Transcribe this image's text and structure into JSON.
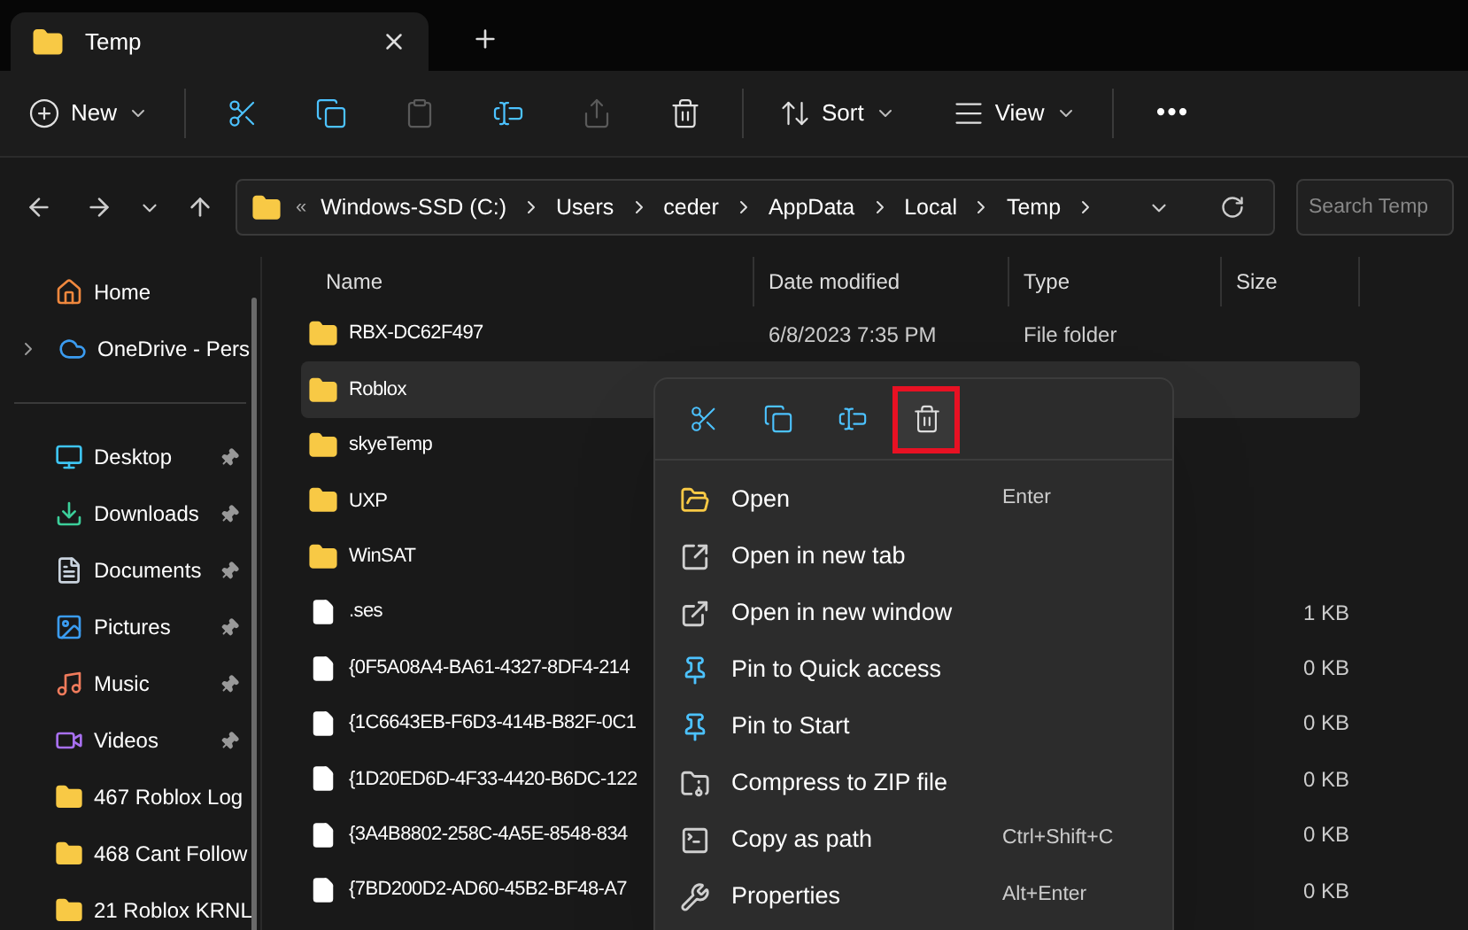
{
  "tab": {
    "title": "Temp",
    "selected": true
  },
  "toolbar": [
    {
      "kind": "new",
      "label": "New",
      "disabled": false
    },
    {
      "kind": "cut",
      "disabled": false
    },
    {
      "kind": "copy",
      "disabled": false
    },
    {
      "kind": "paste",
      "disabled": true
    },
    {
      "kind": "rename",
      "disabled": false
    },
    {
      "kind": "share",
      "disabled": true
    },
    {
      "kind": "delete",
      "disabled": false
    },
    {
      "kind": "sort",
      "label": "Sort",
      "disabled": false
    },
    {
      "kind": "view",
      "label": "View",
      "disabled": false
    },
    {
      "kind": "more",
      "label": "•••",
      "disabled": false
    }
  ],
  "address": {
    "overflow": "«",
    "crumbs": [
      "Windows-SSD (C:)",
      "Users",
      "ceder",
      "AppData",
      "Local",
      "Temp"
    ]
  },
  "search": {
    "placeholder": "Search Temp"
  },
  "sidebar": {
    "items": [
      {
        "kind": "home",
        "label": "Home",
        "pinned": false
      },
      {
        "kind": "cloud",
        "label": "OneDrive - Pers",
        "pinned": false
      },
      {
        "kind": "desktop",
        "label": "Desktop",
        "pinned": true
      },
      {
        "kind": "downloads",
        "label": "Downloads",
        "pinned": true
      },
      {
        "kind": "documents",
        "label": "Documents",
        "pinned": true
      },
      {
        "kind": "pictures",
        "label": "Pictures",
        "pinned": true
      },
      {
        "kind": "music",
        "label": "Music",
        "pinned": true
      },
      {
        "kind": "videos",
        "label": "Videos",
        "pinned": true
      },
      {
        "kind": "folder",
        "label": "467 Roblox Log",
        "pinned": false
      },
      {
        "kind": "folder",
        "label": "468 Cant Follow",
        "pinned": false
      },
      {
        "kind": "folder",
        "label": "21 Roblox KRNL",
        "pinned": false
      }
    ]
  },
  "table": {
    "columns": [
      "Name",
      "Date modified",
      "Type",
      "Size"
    ],
    "rows": [
      {
        "kind": "folder",
        "name": "RBX-DC62F497",
        "date": "6/8/2023 7:35 PM",
        "type": "File folder",
        "selected": false
      },
      {
        "kind": "folder",
        "name": "Roblox",
        "selected": true
      },
      {
        "kind": "folder",
        "name": "skyeTemp",
        "selected": false
      },
      {
        "kind": "folder",
        "name": "UXP",
        "selected": false
      },
      {
        "kind": "folder",
        "name": "WinSAT",
        "selected": false
      },
      {
        "kind": "file",
        "name": ".ses",
        "size": "1 KB",
        "selected": false
      },
      {
        "kind": "file",
        "name": "{0F5A08A4-BA61-4327-8DF4-214",
        "size": "0 KB",
        "selected": false
      },
      {
        "kind": "file",
        "name": "{1C6643EB-F6D3-414B-B82F-0C1",
        "size": "0 KB",
        "selected": false
      },
      {
        "kind": "file",
        "name": "{1D20ED6D-4F33-4420-B6DC-122",
        "size": "0 KB",
        "selected": false
      },
      {
        "kind": "file",
        "name": "{3A4B8802-258C-4A5E-8548-834",
        "size": "0 KB",
        "selected": false
      },
      {
        "kind": "file",
        "name": "{7BD200D2-AD60-45B2-BF48-A7",
        "size": "0 KB",
        "selected": false
      }
    ]
  },
  "context_menu": {
    "actions": [
      {
        "kind": "cut",
        "highlighted": false
      },
      {
        "kind": "copy",
        "highlighted": false
      },
      {
        "kind": "rename",
        "highlighted": false
      },
      {
        "kind": "delete",
        "highlighted": true
      }
    ],
    "items": [
      {
        "kind": "open",
        "label": "Open",
        "shortcut": "Enter"
      },
      {
        "kind": "tab",
        "label": "Open in new tab"
      },
      {
        "kind": "window",
        "label": "Open in new window"
      },
      {
        "kind": "pin",
        "label": "Pin to Quick access"
      },
      {
        "kind": "pin",
        "label": "Pin to Start"
      },
      {
        "kind": "zip",
        "label": "Compress to ZIP file"
      },
      {
        "kind": "path",
        "label": "Copy as path",
        "shortcut": "Ctrl+Shift+C"
      },
      {
        "kind": "wrench",
        "label": "Properties",
        "shortcut": "Alt+Enter"
      }
    ]
  }
}
